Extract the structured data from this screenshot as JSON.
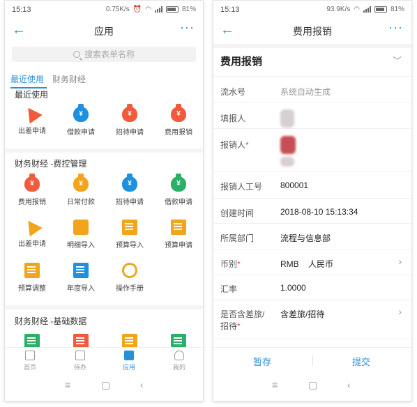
{
  "left": {
    "status": {
      "time": "15:13",
      "speed": "0.75K/s",
      "battery": "81%"
    },
    "nav": {
      "back": "←",
      "title": "应用",
      "more": "···"
    },
    "search_placeholder": "搜索表单名称",
    "tabs": [
      "最近使用",
      "财务财经"
    ],
    "sections": [
      {
        "title": "最近使用",
        "items": [
          {
            "label": "出差申请",
            "icon": "paper-plane-icon",
            "color": "#f15b3c"
          },
          {
            "label": "借款申请",
            "icon": "money-bag-icon",
            "color": "#1e90e0"
          },
          {
            "label": "招待申请",
            "icon": "money-bag-icon",
            "color": "#f15b3c"
          },
          {
            "label": "费用报销",
            "icon": "money-bag-icon",
            "color": "#f15b3c"
          }
        ]
      },
      {
        "title": "财务财经 -费控管理",
        "items": [
          {
            "label": "费用报销",
            "icon": "money-bag-icon",
            "color": "#f15b3c"
          },
          {
            "label": "日常付款",
            "icon": "money-bag-icon",
            "color": "#f2a51c"
          },
          {
            "label": "招待申请",
            "icon": "money-bag-icon",
            "color": "#1e90e0"
          },
          {
            "label": "借款申请",
            "icon": "money-bag-icon",
            "color": "#2ab067"
          },
          {
            "label": "出差申请",
            "icon": "paper-plane-icon",
            "color": "#f2a51c"
          },
          {
            "label": "明细导入",
            "icon": "layers-icon",
            "color": "#f2a51c"
          },
          {
            "label": "预算导入",
            "icon": "document-icon",
            "color": "#f2a51c"
          },
          {
            "label": "预算申请",
            "icon": "document-icon",
            "color": "#f2a51c"
          },
          {
            "label": "预算调整",
            "icon": "document-icon",
            "color": "#f2a51c"
          },
          {
            "label": "年度导入",
            "icon": "document-icon",
            "color": "#1e90e0"
          },
          {
            "label": "操作手册",
            "icon": "refresh-icon",
            "color": "#f2a51c"
          }
        ]
      },
      {
        "title": "财务财经 -基础数据",
        "items": [
          {
            "label": "",
            "icon": "document-icon",
            "color": "#2ab067"
          },
          {
            "label": "",
            "icon": "document-icon",
            "color": "#f15b3c"
          },
          {
            "label": "",
            "icon": "document-icon",
            "color": "#f2a51c"
          },
          {
            "label": "",
            "icon": "document-icon",
            "color": "#2ab067"
          }
        ]
      }
    ],
    "bottom_tabs": [
      "首页",
      "待办",
      "应用",
      "我的"
    ]
  },
  "right": {
    "status": {
      "time": "15:13",
      "speed": "93.9K/s",
      "battery": "81%"
    },
    "nav": {
      "back": "←",
      "title": "费用报销",
      "more": "···"
    },
    "form_title": "费用报销",
    "fields": {
      "serial": {
        "label": "流水号",
        "value": "系统自动生成"
      },
      "filler": {
        "label": "填报人"
      },
      "claimant": {
        "label": "报销人",
        "req": "*"
      },
      "claimant_id": {
        "label": "报销人工号",
        "value": "800001"
      },
      "created": {
        "label": "创建时间",
        "value": "2018-08-10 15:13:34"
      },
      "dept": {
        "label": "所属部门",
        "value": "流程与信息部"
      },
      "currency": {
        "label": "币别",
        "req": "*",
        "value": "RMB    人民币"
      },
      "rate": {
        "label": "汇率",
        "value": "1.0000"
      },
      "travel": {
        "label1": "是否含差旅/",
        "label2": "招待",
        "req": "*",
        "value": "含差旅/招待"
      }
    },
    "actions": {
      "save": "暂存",
      "submit": "提交"
    }
  },
  "sysnav": {
    "menu": "≡",
    "home": "▢",
    "back": "‹"
  },
  "colors": {
    "accent": "#2b8fd8"
  }
}
